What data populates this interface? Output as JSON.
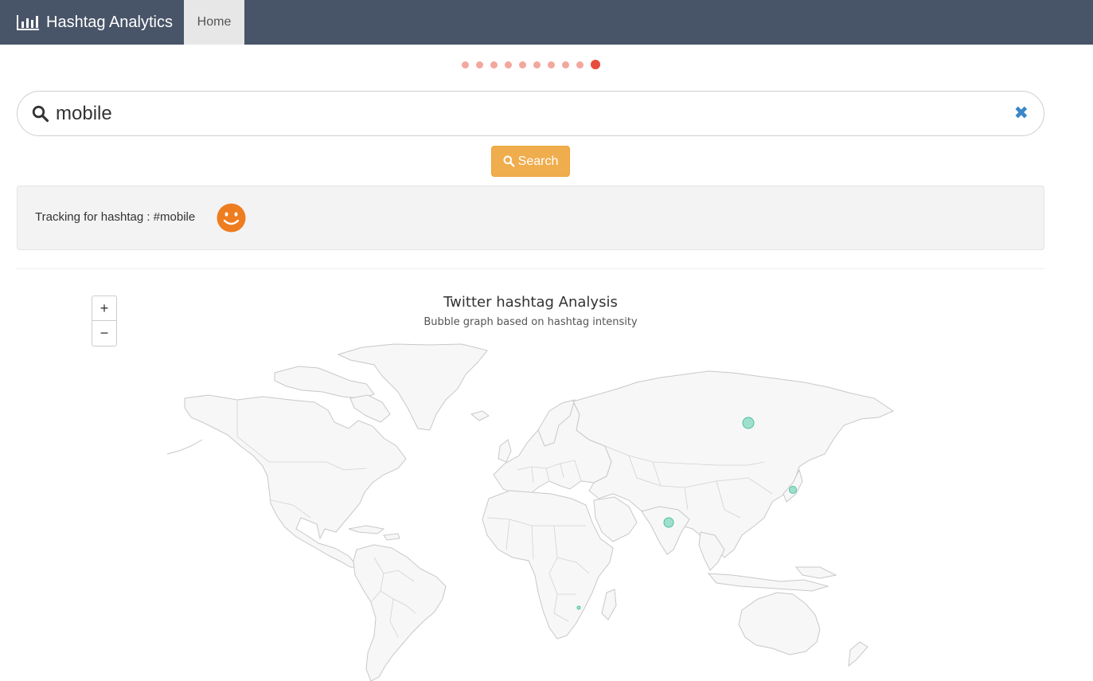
{
  "navbar": {
    "brand": "Hashtag Analytics",
    "home_label": "Home",
    "brand_icon": "bar-chart-icon"
  },
  "carousel": {
    "count": 10,
    "active_index": 9,
    "dot_color": "#f3a79d",
    "active_color": "#e74c3c"
  },
  "search": {
    "value": "mobile",
    "search_icon": "search-icon",
    "clear_icon": "close-icon",
    "button_label": "Search"
  },
  "tracking": {
    "text": "Tracking for hashtag : #mobile",
    "sentiment_icon": "smiley-face-icon"
  },
  "map": {
    "title": "Twitter hashtag Analysis",
    "subtitle": "Bubble graph based on hashtag intensity",
    "zoom_in": "+",
    "zoom_out": "−",
    "bubble_color": "#8fdcc6",
    "bubbles": [
      {
        "location": "Russia",
        "intensity": "large"
      },
      {
        "location": "India",
        "intensity": "large"
      },
      {
        "location": "Japan",
        "intensity": "medium"
      },
      {
        "location": "Mozambique",
        "intensity": "small"
      }
    ]
  },
  "colors": {
    "navbar": "#485468",
    "button": "#f0ad4e",
    "smiley": "#ee7d20"
  }
}
